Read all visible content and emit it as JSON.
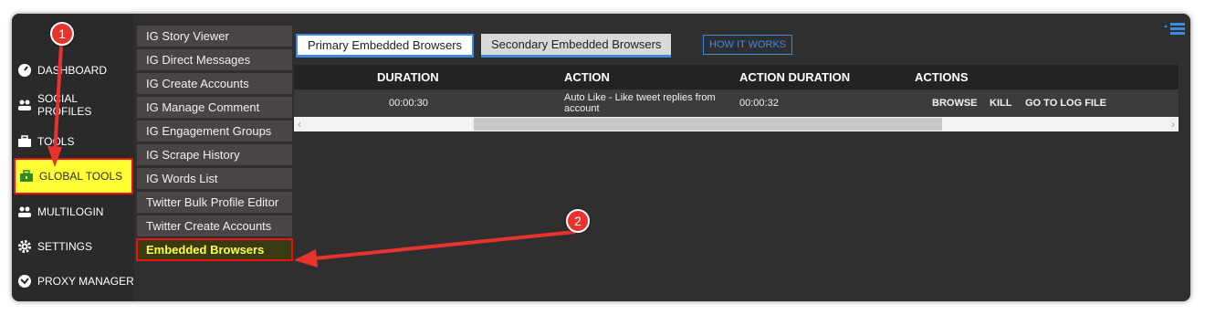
{
  "sidebar": {
    "items": [
      {
        "label": "DASHBOARD",
        "icon": "gauge-icon"
      },
      {
        "label": "SOCIAL PROFILES",
        "icon": "users-icon"
      },
      {
        "label": "TOOLS",
        "icon": "toolbox-icon"
      },
      {
        "label": "GLOBAL TOOLS",
        "icon": "global-toolbox-icon"
      },
      {
        "label": "MULTILOGIN",
        "icon": "users-icon"
      },
      {
        "label": "SETTINGS",
        "icon": "gear-icon"
      },
      {
        "label": "PROXY MANAGER",
        "icon": "proxy-icon"
      }
    ]
  },
  "submenu": {
    "items": [
      "IG Story Viewer",
      "IG Direct Messages",
      "IG Create Accounts",
      "IG Manage Comment",
      "IG Engagement Groups",
      "IG Scrape History",
      "IG Words List",
      "Twitter Bulk Profile Editor",
      "Twitter Create Accounts",
      "Embedded Browsers"
    ]
  },
  "tabs": {
    "primary": "Primary Embedded Browsers",
    "secondary": "Secondary Embedded Browsers",
    "how_it_works": "HOW IT WORKS"
  },
  "table": {
    "headers": [
      "DURATION",
      "ACTION",
      "ACTION DURATION",
      "ACTIONS"
    ],
    "rows": [
      {
        "duration": "00:00:30",
        "action": "Auto Like - Like tweet replies from account",
        "action_duration": "00:00:32",
        "links": [
          "BROWSE",
          "KILL",
          "GO TO LOG FILE"
        ]
      }
    ]
  },
  "annotations": {
    "step1": "1",
    "step2": "2"
  },
  "colors": {
    "accent_blue": "#3d8be0",
    "highlight_yellow": "#ffff33",
    "annotation_red": "#e8322d"
  }
}
